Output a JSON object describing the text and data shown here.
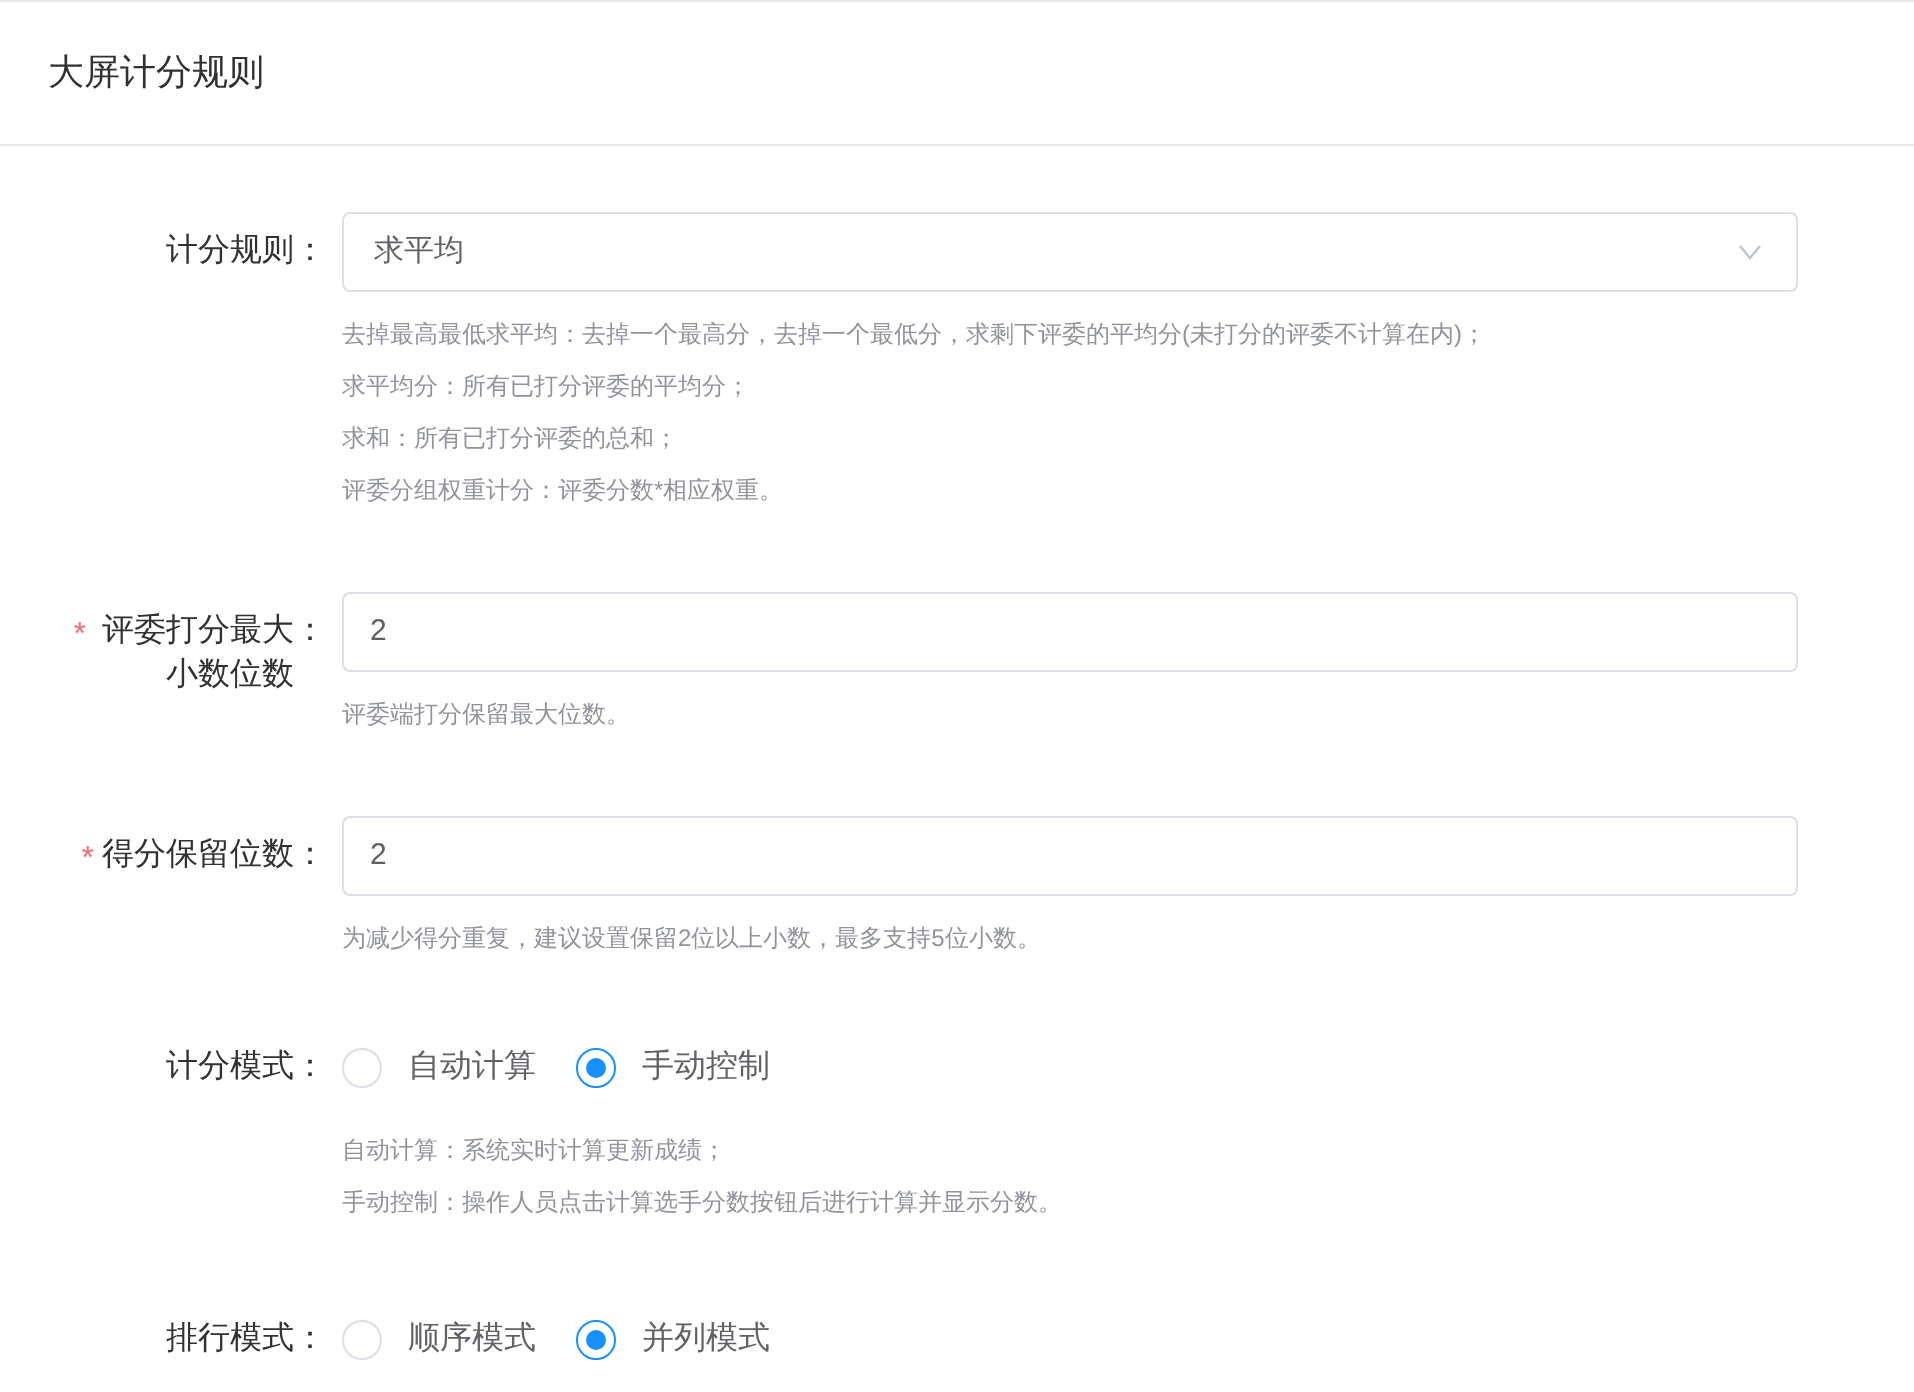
{
  "title": "大屏计分规则",
  "fields": [
    {
      "kind": "select",
      "label": "计分规则",
      "colon": "：",
      "required": false,
      "value": "求平均",
      "help": [
        "去掉最高最低求平均：去掉一个最高分，去掉一个最低分，求剩下评委的平均分(未打分的评委不计算在内)；",
        "求平均分：所有已打分评委的平均分；",
        "求和：所有已打分评委的总和；",
        "评委分组权重计分：评委分数*相应权重。"
      ]
    },
    {
      "kind": "input",
      "label": "评委打分最大小数位数",
      "colon": "：",
      "required": true,
      "value": "2",
      "help": [
        "评委端打分保留最大位数。"
      ]
    },
    {
      "kind": "input",
      "label": "得分保留位数",
      "colon": "：",
      "required": true,
      "value": "2",
      "help": [
        "为减少得分重复，建议设置保留2位以上小数，最多支持5位小数。"
      ]
    },
    {
      "kind": "radio",
      "label": "计分模式",
      "colon": "：",
      "required": false,
      "options": [
        {
          "label": "自动计算",
          "selected": false
        },
        {
          "label": "手动控制",
          "selected": true
        }
      ],
      "help": [
        "自动计算：系统实时计算更新成绩；",
        "手动控制：操作人员点击计算选手分数按钮后进行计算并显示分数。"
      ]
    },
    {
      "kind": "radio",
      "label": "排行模式",
      "colon": "：",
      "required": false,
      "options": [
        {
          "label": "顺序模式",
          "selected": false
        },
        {
          "label": "并列模式",
          "selected": true
        }
      ]
    }
  ],
  "required_mark": "*"
}
